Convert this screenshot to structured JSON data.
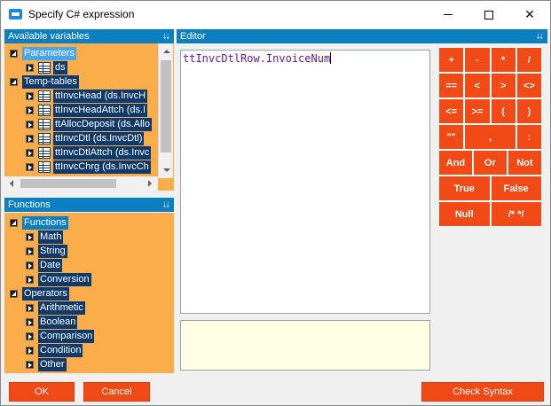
{
  "window": {
    "title": "Specify C# expression"
  },
  "variables": {
    "header": "Available variables",
    "pin": "⮇",
    "rows": [
      {
        "label": "Parameters",
        "indent": 0,
        "type": "folder",
        "state": "sel"
      },
      {
        "label": "ds",
        "indent": 1,
        "type": "table",
        "state": ""
      },
      {
        "label": "Temp-tables",
        "indent": 0,
        "type": "folder",
        "state": ""
      },
      {
        "label": "ttInvcHead (ds.InvcH",
        "indent": 1,
        "type": "table",
        "state": ""
      },
      {
        "label": "ttInvcHeadAttch (ds.I",
        "indent": 1,
        "type": "table",
        "state": ""
      },
      {
        "label": "ttAllocDeposit (ds.Allo",
        "indent": 1,
        "type": "table",
        "state": ""
      },
      {
        "label": "ttInvcDtl (ds.InvcDtl)",
        "indent": 1,
        "type": "table",
        "state": ""
      },
      {
        "label": "ttInvcDtlAttch (ds.Invc",
        "indent": 1,
        "type": "table",
        "state": ""
      },
      {
        "label": "ttInvcChrg (ds.InvcCh",
        "indent": 1,
        "type": "table",
        "state": ""
      }
    ]
  },
  "functions": {
    "header": "Functions",
    "pin": "⮇",
    "rows": [
      {
        "label": "Functions",
        "indent": 0,
        "type": "open",
        "state": "hl"
      },
      {
        "label": "Math",
        "indent": 1,
        "type": "closed",
        "state": ""
      },
      {
        "label": "String",
        "indent": 1,
        "type": "closed",
        "state": ""
      },
      {
        "label": "Date",
        "indent": 1,
        "type": "closed",
        "state": ""
      },
      {
        "label": "Conversion",
        "indent": 1,
        "type": "closed",
        "state": ""
      },
      {
        "label": "Operators",
        "indent": 0,
        "type": "open",
        "state": ""
      },
      {
        "label": "Arithmetic",
        "indent": 1,
        "type": "closed",
        "state": ""
      },
      {
        "label": "Boolean",
        "indent": 1,
        "type": "closed",
        "state": ""
      },
      {
        "label": "Comparison",
        "indent": 1,
        "type": "closed",
        "state": ""
      },
      {
        "label": "Condition",
        "indent": 1,
        "type": "closed",
        "state": ""
      },
      {
        "label": "Other",
        "indent": 1,
        "type": "closed",
        "state": ""
      }
    ]
  },
  "editor": {
    "header": "Editor",
    "pin": "⮇",
    "text": "ttInvcDtlRow.InvoiceNum"
  },
  "operators": [
    {
      "label": "+",
      "row": 0,
      "col": 0,
      "span": 1
    },
    {
      "label": "-",
      "row": 0,
      "col": 1,
      "span": 1
    },
    {
      "label": "*",
      "row": 0,
      "col": 2,
      "span": 1
    },
    {
      "label": "/",
      "row": 0,
      "col": 3,
      "span": 1
    },
    {
      "label": "==",
      "row": 1,
      "col": 0,
      "span": 1
    },
    {
      "label": "<",
      "row": 1,
      "col": 1,
      "span": 1
    },
    {
      "label": ">",
      "row": 1,
      "col": 2,
      "span": 1
    },
    {
      "label": "<>",
      "row": 1,
      "col": 3,
      "span": 1
    },
    {
      "label": "<=",
      "row": 2,
      "col": 0,
      "span": 1
    },
    {
      "label": ">=",
      "row": 2,
      "col": 1,
      "span": 1
    },
    {
      "label": "(",
      "row": 2,
      "col": 2,
      "span": 1
    },
    {
      "label": ")",
      "row": 2,
      "col": 3,
      "span": 1
    },
    {
      "label": "\"\"",
      "row": 3,
      "col": 0,
      "span": 1
    },
    {
      "label": ",",
      "row": 3,
      "col": 1,
      "span": 2
    },
    {
      "label": ":",
      "row": 3,
      "col": 3,
      "span": 1
    },
    {
      "label": "And",
      "row": 4,
      "col": 0,
      "span": 1.33
    },
    {
      "label": "Or",
      "row": 4,
      "col": 1.33,
      "span": 1.33
    },
    {
      "label": "Not",
      "row": 4,
      "col": 2.66,
      "span": 1.34
    },
    {
      "label": "True",
      "row": 5,
      "col": 0,
      "span": 2
    },
    {
      "label": "False",
      "row": 5,
      "col": 2,
      "span": 2
    },
    {
      "label": "Null",
      "row": 6,
      "col": 0,
      "span": 2
    },
    {
      "label": "/* */",
      "row": 6,
      "col": 2,
      "span": 2
    }
  ],
  "buttons": {
    "ok": "OK",
    "cancel": "Cancel",
    "check": "Check Syntax"
  },
  "colors": {
    "accent": "#0c7fc0",
    "orange_panel": "#fbad4b",
    "button": "#f24a17",
    "node_bg": "#0f3a6b"
  }
}
